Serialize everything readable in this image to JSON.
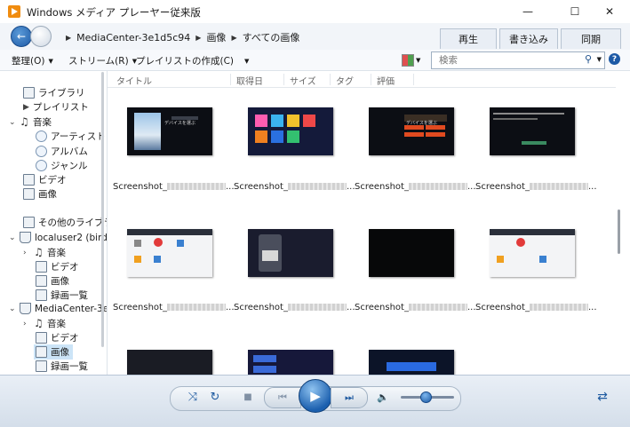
{
  "window": {
    "title": "Windows メディア プレーヤー従来版",
    "minimize": "—",
    "maximize": "☐",
    "close": "✕"
  },
  "nav": {
    "back": "←",
    "breadcrumb": [
      "MediaCenter-3e1d5c94",
      "画像",
      "すべての画像"
    ],
    "tabs": [
      "再生",
      "書き込み",
      "同期"
    ]
  },
  "toolbar": {
    "organize": "整理(O)",
    "stream": "ストリーム(R)",
    "create_playlist": "プレイリストの作成(C)",
    "search_placeholder": "検索",
    "help": "?"
  },
  "sidebar": {
    "items": [
      {
        "label": "ライブラリ"
      },
      {
        "label": "プレイリスト"
      },
      {
        "label": "音楽"
      },
      {
        "label": "アーティスト"
      },
      {
        "label": "アルバム"
      },
      {
        "label": "ジャンル"
      },
      {
        "label": "ビデオ"
      },
      {
        "label": "画像"
      },
      {
        "label": "その他のライブラリ"
      },
      {
        "label": "localuser2 (bird"
      },
      {
        "label": "音楽"
      },
      {
        "label": "ビデオ"
      },
      {
        "label": "画像"
      },
      {
        "label": "録画一覧"
      },
      {
        "label": "MediaCenter-3e"
      },
      {
        "label": "音楽"
      },
      {
        "label": "ビデオ"
      },
      {
        "label": "画像"
      },
      {
        "label": "録画一覧"
      }
    ]
  },
  "columns": [
    "タイトル",
    "取得日",
    "サイズ",
    "タグ",
    "評価"
  ],
  "images": {
    "caption_prefix": "Screenshot_",
    "caption_suffix": "...",
    "thumb_label": "デバイスを選ぶ"
  },
  "player": {
    "shuffle": "⤨",
    "repeat": "↻",
    "stop": "■",
    "prev": "⏮",
    "play": "▶",
    "next": "⏭",
    "volume": "🔈",
    "volume_level": 0.45,
    "switch_view": "⇄"
  },
  "colors": {
    "accent": "#1d5aa6",
    "toolbar_bg": "#f7f9fc",
    "player_bg": "#dbe4ee"
  }
}
